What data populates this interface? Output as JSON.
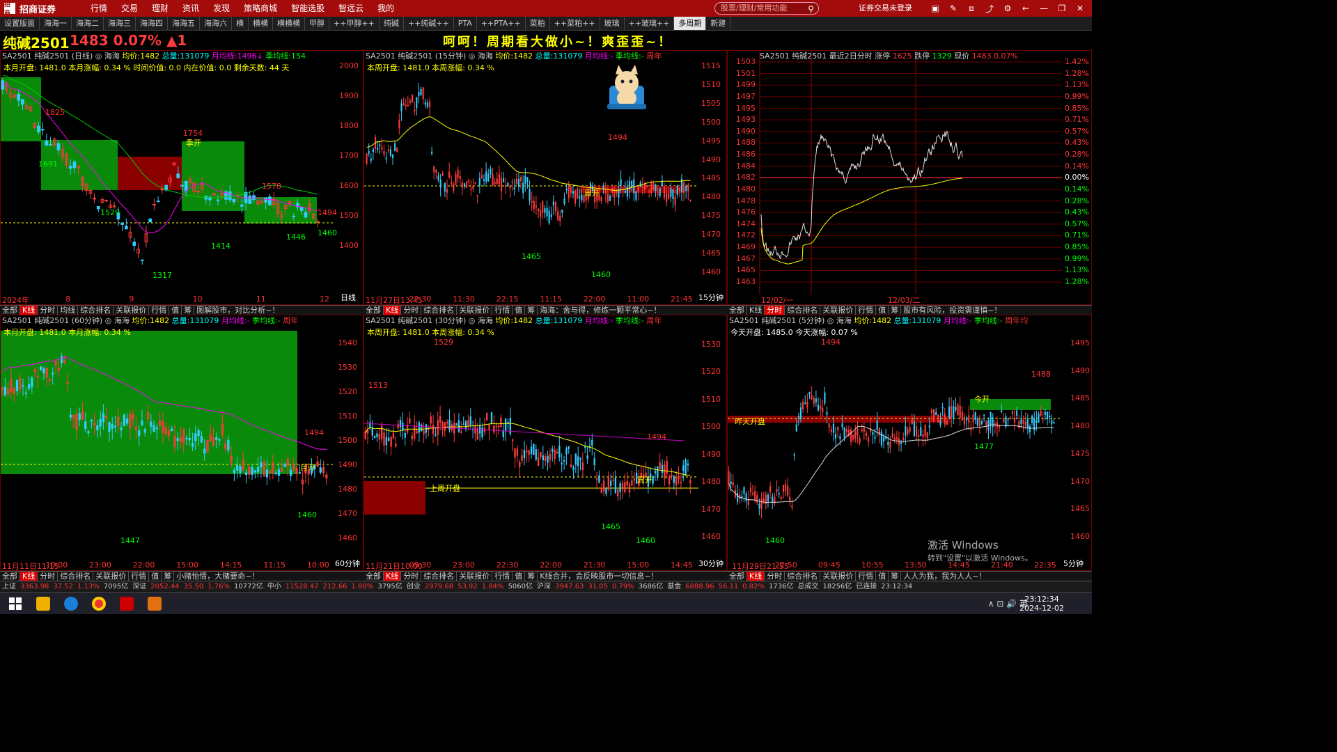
{
  "app": {
    "name": "招商证券",
    "logo_text": "招商",
    "search_placeholder": "股票/理财/常用功能",
    "login_status": "证券交易未登录",
    "menu": [
      "行情",
      "交易",
      "理财",
      "资讯",
      "发现",
      "策略商城",
      "智能选股",
      "智远云",
      "我的"
    ]
  },
  "tabs": [
    "设置版面",
    "海海一",
    "海海二",
    "海海三",
    "海海四",
    "海海五",
    "海海六",
    "横",
    "横横",
    "横横横",
    "甲醇",
    "++甲醇++",
    "纯碱",
    "++纯碱++",
    "PTA",
    "++PTA++",
    "菜粕",
    "++菜粕++",
    "玻璃",
    "++玻璃++",
    "多周期",
    "新建"
  ],
  "active_tab": "多周期",
  "header": {
    "name": "纯碱2501",
    "price": "1483",
    "change_pct": "0.07%",
    "change": "▲1",
    "slogan": "呵呵！周期看大做小~！爽歪歪~！"
  },
  "panels": {
    "daily": {
      "code": "SA2501",
      "name": "纯碱2501 (日线)",
      "sep": "◎",
      "market": "海海",
      "avg_label": "均价:",
      "avg": "1482",
      "vol_label": "总量:",
      "vol": "131079",
      "ma1_label": "月均线:",
      "ma1": "1496↓",
      "ma2_label": "季均线:",
      "ma2": "154",
      "info": "本月开盘:  1481.0   本月涨幅:  0.34 %  时间价值:  0.0  内在价值:  0.0   剩余天数:  44 天",
      "yaxis": [
        "2000",
        "1900",
        "1800",
        "1700",
        "1600",
        "1500",
        "1400"
      ],
      "period": "日线",
      "xaxis": [
        "2024年",
        "8",
        "9",
        "10",
        "11",
        "12"
      ],
      "labels": {
        "l1825": "1825",
        "l1691": "1691",
        "l1754": "1754",
        "jk": "季开",
        "l1578": "1578",
        "l1529": "1529",
        "l1494": "1494",
        "l1414": "1414",
        "l1446": "1446",
        "l1460": "1460",
        "l1317": "1317"
      }
    },
    "m15": {
      "code": "SA2501",
      "name": "纯碱2501 (15分钟)",
      "sep": "◎",
      "market": "海海",
      "avg_label": "均价:",
      "avg": "1482",
      "vol_label": "总量:",
      "vol": "131079",
      "ma1_label": "月均线:",
      "ma1": "-",
      "ma2_label": "季均线:",
      "ma2": "-",
      "ma3": "周年",
      "info": "本周开盘:  1481.0   本周涨幅:  0.34 %",
      "yaxis": [
        "1515",
        "1510",
        "1505",
        "1500",
        "1495",
        "1490",
        "1485",
        "1480",
        "1475",
        "1470",
        "1465",
        "1460"
      ],
      "period": "15分钟",
      "xaxis": [
        "11月27日13:45",
        "22:30",
        "11:30",
        "22:15",
        "11:15",
        "22:00",
        "11:00",
        "21:45"
      ],
      "labels": {
        "l1494": "1494",
        "zk": "周开",
        "l1465": "1465",
        "l1460": "1460"
      }
    },
    "intraday": {
      "title": "SA2501 纯碱2501   最近2日分时  涨停 ",
      "limit_up": "1625",
      "limit_down_label": "跌停",
      "limit_down": "1329",
      "cur_label": "现价",
      "cur": "1483",
      "cur_pct": "0.07%",
      "yaxis": [
        "1503",
        "1501",
        "1499",
        "1497",
        "1495",
        "1493",
        "1490",
        "1488",
        "1486",
        "1484",
        "1482",
        "1480",
        "1478",
        "1476",
        "1474",
        "1472",
        "1469",
        "1467",
        "1465",
        "1463"
      ],
      "pct": [
        "1.42%",
        "1.28%",
        "1.13%",
        "0.99%",
        "0.85%",
        "0.71%",
        "0.57%",
        "0.43%",
        "0.28%",
        "0.14%",
        "0.00%",
        "0.14%",
        "0.28%",
        "0.43%",
        "0.57%",
        "0.71%",
        "0.85%",
        "0.99%",
        "1.13%",
        "1.28%"
      ],
      "xaxis": [
        "12/02/一",
        "12/03/二"
      ]
    },
    "m60": {
      "code": "SA2501",
      "name": "纯碱2501 (60分钟)",
      "sep": "◎",
      "market": "海海",
      "avg_label": "均价:",
      "avg": "1482",
      "vol_label": "总量:",
      "vol": "131079",
      "ma1_label": "月均线:",
      "ma1": "-",
      "ma2_label": "季均线:",
      "ma2": "-",
      "ma3": "周年",
      "info": "本月开盘:  1481.0   本月涨幅:  0.34 %",
      "yaxis": [
        "1540",
        "1530",
        "1520",
        "1510",
        "1500",
        "1490",
        "1480",
        "1470",
        "1460"
      ],
      "period": "60分钟",
      "xaxis": [
        "11月11日11:15",
        "10:00",
        "23:00",
        "22:00",
        "15:00",
        "14:15",
        "11:15",
        "10:00"
      ],
      "labels": {
        "l1494": "1494",
        "yk": "月开",
        "l1460": "1460",
        "l1447": "1447"
      }
    },
    "m30": {
      "code": "SA2501",
      "name": "纯碱2501 (30分钟)",
      "sep": "◎",
      "market": "海海",
      "avg_label": "均价:",
      "avg": "1482",
      "vol_label": "总量:",
      "vol": "131079",
      "ma1_label": "月均线:",
      "ma1": "-",
      "ma2_label": "季均线:",
      "ma2": "-",
      "ma3": "周年",
      "info": "本周开盘:  1481.0   本周涨幅:  0.34 %",
      "yaxis": [
        "1530",
        "1520",
        "1510",
        "1500",
        "1490",
        "1480",
        "1470",
        "1460"
      ],
      "period": "30分钟",
      "xaxis": [
        "11月21日10:00",
        "09:30",
        "23:00",
        "22:30",
        "22:00",
        "21:30",
        "15:00",
        "14:45"
      ],
      "labels": {
        "l1529": "1529",
        "l1513": "1513",
        "l1494": "1494",
        "swk": "上周开盘",
        "zk": "周开",
        "l1465": "1465",
        "l1460": "1460"
      }
    },
    "m5": {
      "code": "SA2501",
      "name": "纯碱2501 (5分钟)",
      "sep": "◎",
      "market": "海海",
      "avg_label": "均价:",
      "avg": "1482",
      "vol_label": "总量:",
      "vol": "131079",
      "ma1_label": "月均线:",
      "ma1": "-",
      "ma2_label": "季均线:",
      "ma2": "-",
      "ma3": "周年均",
      "info": "今天开盘:  1485.0   今天涨幅:  0.07 %",
      "yaxis": [
        "1495",
        "1490",
        "1485",
        "1480",
        "1475",
        "1470",
        "1465",
        "1460"
      ],
      "period": "5分钟",
      "xaxis": [
        "11月29日21:55",
        "22:50",
        "09:45",
        "10:55",
        "13:50",
        "14:45",
        "21:40",
        "22:35"
      ],
      "labels": {
        "l1494": "1494",
        "l1488": "1488",
        "jk": "今开",
        "ztk": "昨天开盘",
        "l1477": "1477",
        "l1460": "1460"
      }
    }
  },
  "subtabs": {
    "daily": [
      "全部",
      "K线",
      "分时",
      "均线",
      "综合排名",
      "关联报价",
      "行情",
      "值",
      "筹"
    ],
    "daily_msg": "图解股市，对比分析~！",
    "m15": [
      "全部",
      "K线",
      "分时",
      "综合排名",
      "关联报价",
      "行情",
      "值",
      "筹"
    ],
    "m15_msg": "海海：舍与得，修炼一颗平常心~！",
    "intra": [
      "全部",
      "K线",
      "分时",
      "综合排名",
      "关联报价",
      "行情",
      "值",
      "筹"
    ],
    "intra_msg": "股市有风险，投资需谨慎~！",
    "m60": [
      "全部",
      "K线",
      "分时",
      "综合排名",
      "关联报价",
      "行情",
      "值",
      "筹"
    ],
    "m60_msg": "小赌怡情，大赌要命~！",
    "m30": [
      "全部",
      "K线",
      "分时",
      "综合排名",
      "关联报价",
      "行情",
      "值",
      "筹"
    ],
    "m30_msg": "K线合并，会反映股市一切信息~！",
    "m5": [
      "全部",
      "K线",
      "分时",
      "综合排名",
      "关联报价",
      "行情",
      "值",
      "筹"
    ],
    "m5_msg": "人人为我，我为人人~！"
  },
  "statusbar": [
    {
      "t": "上证",
      "c": "#ccc"
    },
    {
      "t": "3363.98",
      "c": "#f33"
    },
    {
      "t": "37.52",
      "c": "#f33"
    },
    {
      "t": "1.13%",
      "c": "#f33"
    },
    {
      "t": "7095亿",
      "c": "#ccc"
    },
    {
      "t": "深证",
      "c": "#ccc"
    },
    {
      "t": "2052.44",
      "c": "#f33"
    },
    {
      "t": "35.50",
      "c": "#f33"
    },
    {
      "t": "1.76%",
      "c": "#f33"
    },
    {
      "t": "10772亿",
      "c": "#ccc"
    },
    {
      "t": "中小",
      "c": "#ccc"
    },
    {
      "t": "11528.47",
      "c": "#f33"
    },
    {
      "t": "212.66",
      "c": "#f33"
    },
    {
      "t": "1.88%",
      "c": "#f33"
    },
    {
      "t": "3795亿",
      "c": "#ccc"
    },
    {
      "t": "创业",
      "c": "#ccc"
    },
    {
      "t": "2979.68",
      "c": "#f33"
    },
    {
      "t": "53.92",
      "c": "#f33"
    },
    {
      "t": "1.84%",
      "c": "#f33"
    },
    {
      "t": "5060亿",
      "c": "#ccc"
    },
    {
      "t": "沪深",
      "c": "#ccc"
    },
    {
      "t": "3947.63",
      "c": "#f33"
    },
    {
      "t": "31.05",
      "c": "#f33"
    },
    {
      "t": "0.79%",
      "c": "#f33"
    },
    {
      "t": "3686亿",
      "c": "#ccc"
    },
    {
      "t": "基金",
      "c": "#ccc"
    },
    {
      "t": "6888.96",
      "c": "#f33"
    },
    {
      "t": "56.11",
      "c": "#f33"
    },
    {
      "t": "0.82%",
      "c": "#f33"
    },
    {
      "t": "1736亿",
      "c": "#ccc"
    },
    {
      "t": "总成交",
      "c": "#ccc"
    },
    {
      "t": "18256亿",
      "c": "#ccc"
    },
    {
      "t": "已连接",
      "c": "#ccc"
    },
    {
      "t": "23:12:34",
      "c": "#ccc"
    }
  ],
  "watermark": {
    "line1": "激活 Windows",
    "line2": "转到\"设置\"以激活 Windows。"
  },
  "taskbar": {
    "tray": "∧ ⊡ 🔊 英",
    "time": "23:12:34",
    "date": "2024-12-02"
  }
}
